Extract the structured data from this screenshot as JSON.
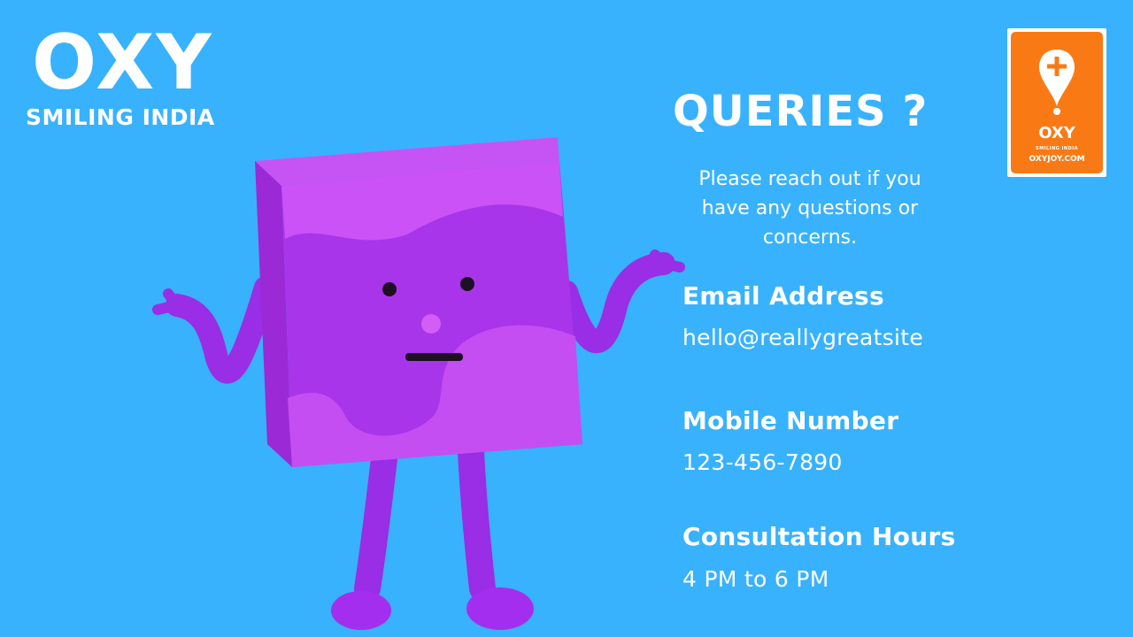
{
  "brand": {
    "name": "OXY",
    "tagline": "SMILING INDIA"
  },
  "logo": {
    "name": "OXY",
    "tagline": "SMILING INDIA",
    "url": "OXYJOY.COM",
    "background_color": "#f97a15",
    "icon": "map-pin-plus-icon"
  },
  "page": {
    "title": "QUERIES ?",
    "intro": "Please reach out if you have any questions or concerns."
  },
  "contact": {
    "email_label": "Email Address",
    "email_value": "hello@reallygreatsite",
    "mobile_label": "Mobile Number",
    "mobile_value": "123-456-7890",
    "hours_label": "Consultation Hours",
    "hours_value": "4 PM to 6 PM"
  },
  "colors": {
    "background": "#38b2fd",
    "mascot_purple": "#a833f0",
    "text": "#ffffff"
  },
  "illustration": {
    "icon": "shrugging-box-mascot"
  }
}
